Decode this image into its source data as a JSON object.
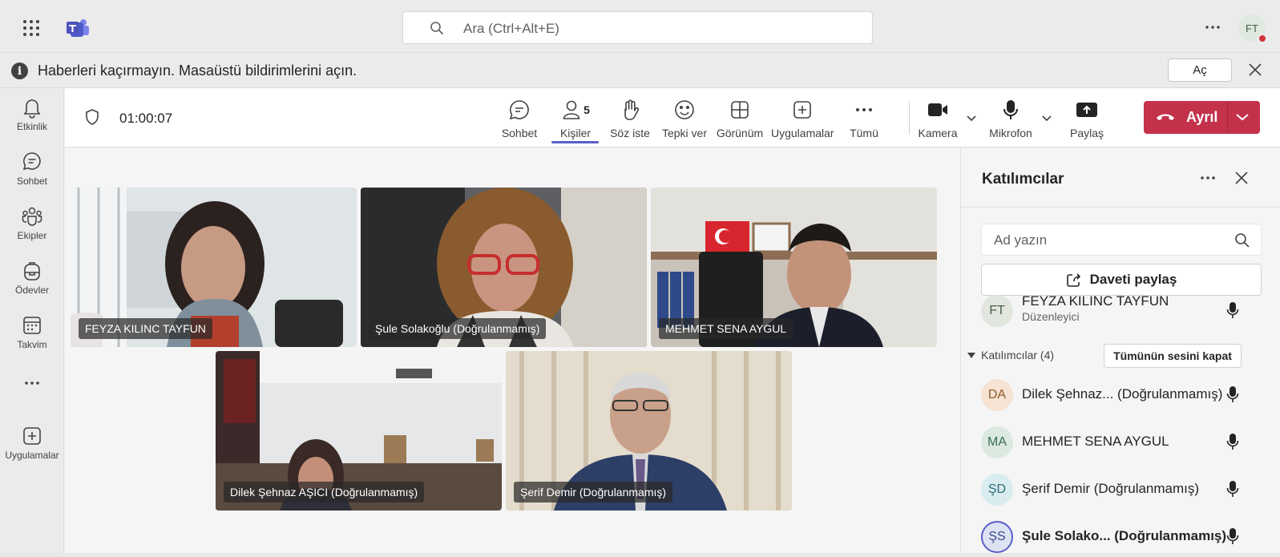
{
  "topbar": {
    "search_placeholder": "Ara (Ctrl+Alt+E)",
    "avatar_initials": "FT",
    "icons": [
      "app-launcher-icon",
      "teams-logo-icon",
      "search-icon",
      "more-icon"
    ]
  },
  "banner": {
    "message": "Haberleri kaçırmayın. Masaüstü bildirimlerini açın.",
    "open_label": "Aç"
  },
  "rail": {
    "items": [
      {
        "label": "Etkinlik",
        "icon": "bell-icon"
      },
      {
        "label": "Sohbet",
        "icon": "chat-icon"
      },
      {
        "label": "Ekipler",
        "icon": "teams-icon"
      },
      {
        "label": "Ödevler",
        "icon": "backpack-icon"
      },
      {
        "label": "Takvim",
        "icon": "calendar-icon"
      },
      {
        "label": "",
        "icon": "more-icon"
      },
      {
        "label": "Uygulamalar",
        "icon": "add-apps-icon"
      }
    ]
  },
  "meeting": {
    "timer": "01:00:07",
    "participant_count": "5",
    "tools": {
      "chat": "Sohbet",
      "people": "Kişiler",
      "raise_hand": "Söz iste",
      "react": "Tepki ver",
      "view": "Görünüm",
      "apps": "Uygulamalar",
      "more": "Tümü",
      "camera": "Kamera",
      "mic": "Mikrofon",
      "share": "Paylaş"
    },
    "leave_label": "Ayrıl",
    "colors": {
      "accent": "#5b5fc7",
      "leave": "#c4314b"
    }
  },
  "videos": [
    {
      "name": "FEYZA KILINC TAYFUN"
    },
    {
      "name": "Şule Solakoğlu (Doğrulanmamış)"
    },
    {
      "name": "MEHMET SENA AYGUL"
    },
    {
      "name": "Dilek Şehnaz AŞICI (Doğrulanmamış)"
    },
    {
      "name": "Şerif Demir (Doğrulanmamış)"
    }
  ],
  "panel": {
    "title": "Katılımcılar",
    "search_placeholder": "Ad yazın",
    "invite_label": "Daveti paylaş",
    "organizer": {
      "initials": "FT",
      "name": "FEYZA KILINC TAYFUN",
      "role": "Düzenleyici"
    },
    "section_label": "Katılımcılar (4)",
    "mute_all_label": "Tümünün sesini kapat",
    "participants": [
      {
        "initials": "DA",
        "name": "Dilek Şehnaz... (Doğrulanmamış)"
      },
      {
        "initials": "MA",
        "name": "MEHMET SENA AYGUL"
      },
      {
        "initials": "ŞD",
        "name": "Şerif Demir (Doğrulanmamış)"
      },
      {
        "initials": "ŞS",
        "name": "Şule Solako... (Doğrulanmamış)"
      }
    ]
  }
}
